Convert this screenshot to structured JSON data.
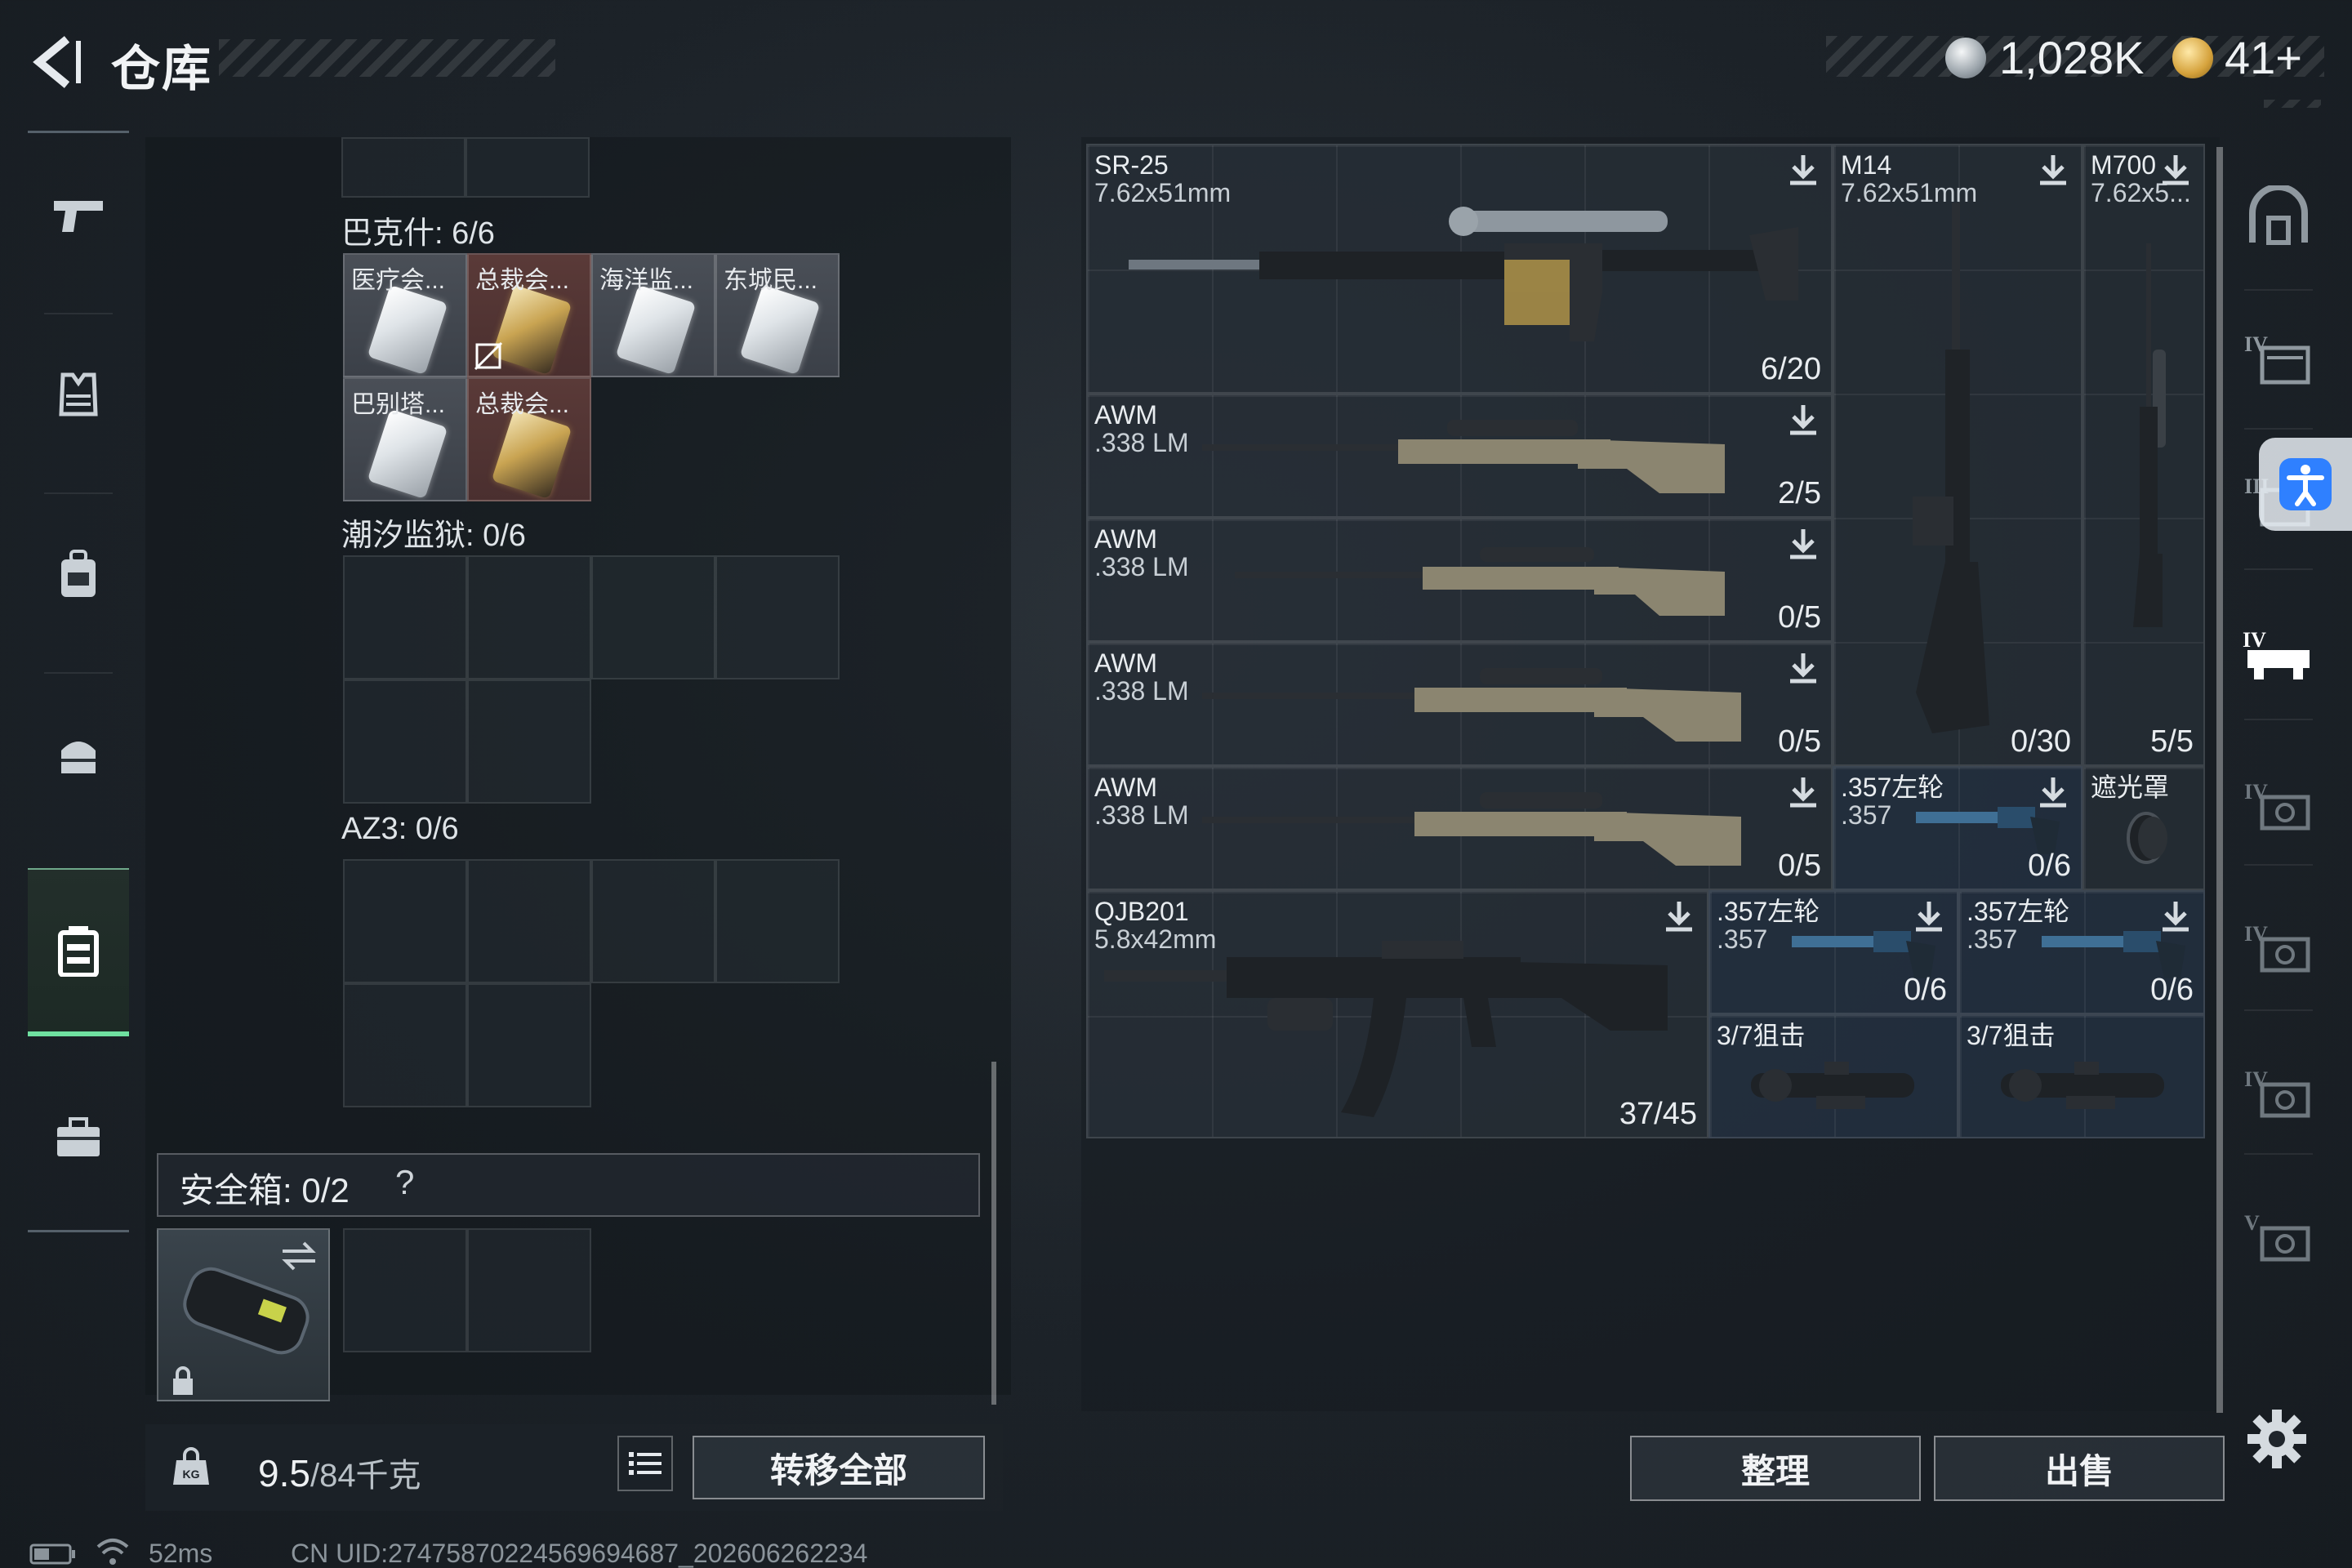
{
  "header": {
    "title": "仓库",
    "currency": {
      "silver": "1,028K",
      "gold": "41+"
    }
  },
  "left_nav": {
    "items": [
      {
        "icon": "pistol-icon"
      },
      {
        "icon": "armor-vest-icon"
      },
      {
        "icon": "backpack-icon"
      },
      {
        "icon": "helmet-bag-icon"
      },
      {
        "icon": "chest-rig-icon",
        "active": true
      },
      {
        "icon": "briefcase-icon"
      }
    ],
    "active_color": "#6fe0a0"
  },
  "storage": {
    "groups": [
      {
        "label": "巴克什: 6/6",
        "items": [
          {
            "name": "医疗会...",
            "style": "white"
          },
          {
            "name": "总裁会...",
            "style": "red",
            "restricted": true
          },
          {
            "name": "海洋监...",
            "style": "white"
          },
          {
            "name": "东城民...",
            "style": "white"
          },
          {
            "name": "巴别塔...",
            "style": "white"
          },
          {
            "name": "总裁会...",
            "style": "red"
          }
        ]
      },
      {
        "label": "潮汐监狱: 0/6",
        "items": []
      },
      {
        "label": "AZ3: 0/6",
        "items": []
      }
    ],
    "safebox": {
      "label": "安全箱: 0/2",
      "help": "?"
    },
    "weight": {
      "current": "9.5",
      "max": "/84千克"
    },
    "transfer_all": "转移全部"
  },
  "weapons": [
    {
      "name": "SR-25",
      "caliber": "7.62x51mm",
      "ammo": "6/20",
      "has_download": true
    },
    {
      "name": "M14",
      "caliber": "7.62x51mm",
      "ammo": "0/30",
      "has_download": true
    },
    {
      "name": "M700",
      "caliber": "7.62x5...",
      "ammo": "5/5",
      "has_download": true
    },
    {
      "name": "AWM",
      "caliber": ".338 LM",
      "ammo": "2/5",
      "has_download": true
    },
    {
      "name": "AWM",
      "caliber": ".338 LM",
      "ammo": "0/5",
      "has_download": true
    },
    {
      "name": "AWM",
      "caliber": ".338 LM",
      "ammo": "0/5",
      "has_download": true
    },
    {
      "name": "AWM",
      "caliber": ".338 LM",
      "ammo": "0/5",
      "has_download": true
    },
    {
      "name": ".357左轮",
      "caliber": ".357",
      "ammo": "0/6",
      "has_download": true
    },
    {
      "name": "遮光罩",
      "caliber": "",
      "ammo": "",
      "has_download": false
    },
    {
      "name": "QJB201",
      "caliber": "5.8x42mm",
      "ammo": "37/45",
      "has_download": true
    },
    {
      "name": ".357左轮",
      "caliber": ".357",
      "ammo": "0/6",
      "has_download": true
    },
    {
      "name": ".357左轮",
      "caliber": ".357",
      "ammo": "0/6",
      "has_download": true
    },
    {
      "name": "3/7狙击",
      "caliber": "",
      "ammo": "",
      "has_download": false
    },
    {
      "name": "3/7狙击",
      "caliber": "",
      "ammo": "",
      "has_download": false
    }
  ],
  "actions": {
    "sort": "整理",
    "sell": "出售"
  },
  "right_nav": {
    "items": [
      {
        "icon": "storage-arch-icon"
      },
      {
        "icon": "storage-tier4-a-icon",
        "label": "IV"
      },
      {
        "icon": "storage-tier3-icon",
        "label": "III"
      },
      {
        "icon": "storage-tier4-b-icon",
        "label": "IV",
        "active": true
      },
      {
        "icon": "storage-tier4-c-icon",
        "label": "IV"
      },
      {
        "icon": "storage-tier4-d-icon",
        "label": "IV"
      },
      {
        "icon": "storage-tier4-e-icon",
        "label": "IV"
      },
      {
        "icon": "storage-tier5-icon",
        "label": "V"
      }
    ]
  },
  "status": {
    "ping": "52ms",
    "uid": "CN UID:274758702245696946​87_202606262234"
  }
}
